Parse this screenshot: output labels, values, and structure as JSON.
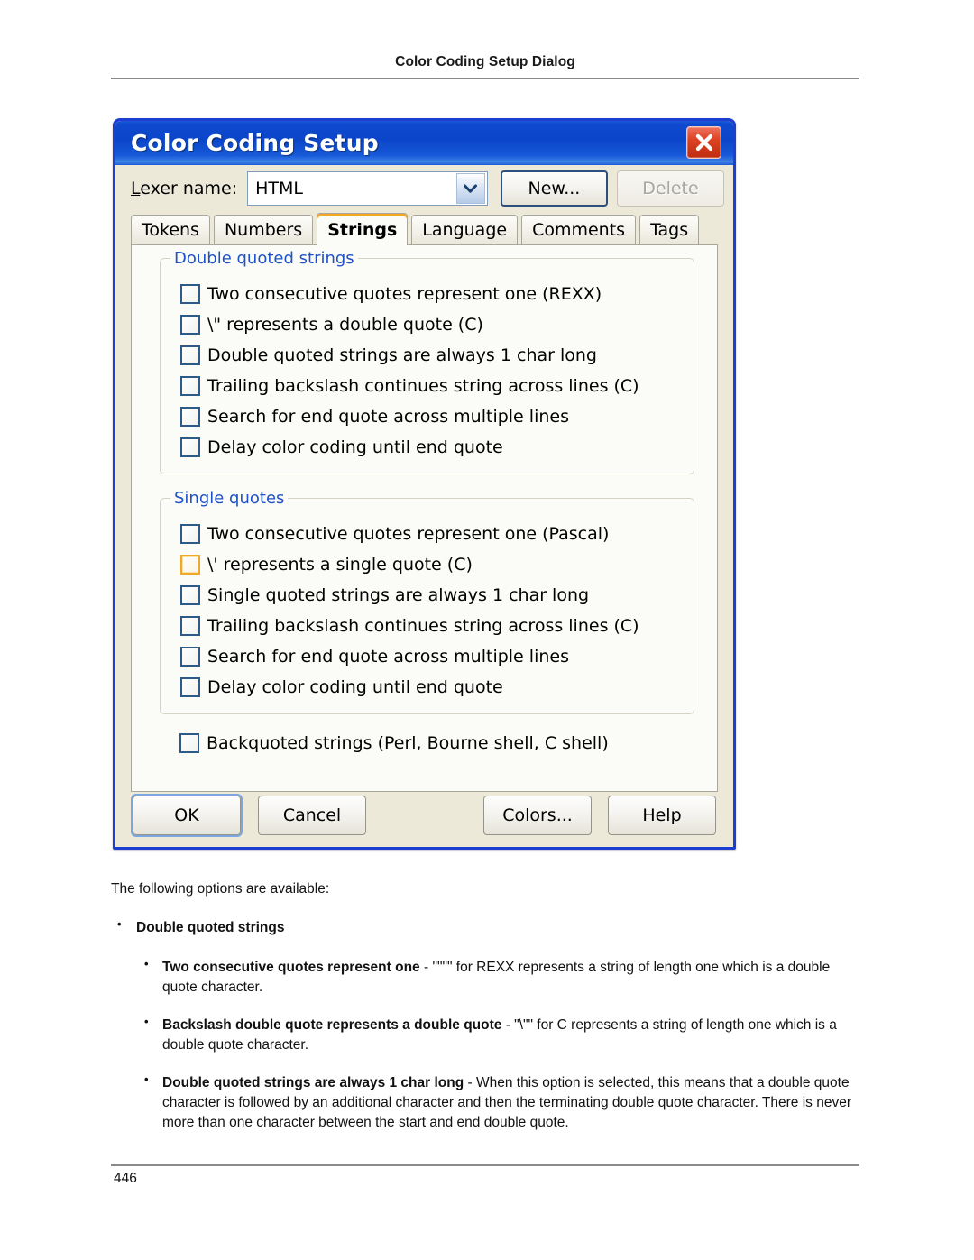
{
  "page": {
    "header_title": "Color Coding Setup Dialog",
    "page_number": "446"
  },
  "dialog": {
    "title": "Color Coding Setup",
    "close_icon": "close-x-icon",
    "lexer": {
      "label_prefix": "L",
      "label_rest": "exer name:",
      "value": "HTML",
      "dropdown_icon": "chevron-down-icon"
    },
    "buttons": {
      "new": "New...",
      "delete": "Delete",
      "ok": "OK",
      "cancel": "Cancel",
      "colors": "Colors...",
      "help": "Help"
    },
    "tabs": [
      {
        "label": "Tokens",
        "active": false
      },
      {
        "label": "Numbers",
        "active": false
      },
      {
        "label": "Strings",
        "active": true
      },
      {
        "label": "Language",
        "active": false
      },
      {
        "label": "Comments",
        "active": false
      },
      {
        "label": "Tags",
        "active": false
      }
    ],
    "groups": [
      {
        "title": "Double quoted strings",
        "items": [
          {
            "label": "Two consecutive quotes represent one (REXX)",
            "checked": false,
            "hover": false
          },
          {
            "label": "\\\" represents a double quote (C)",
            "checked": false,
            "hover": false
          },
          {
            "label": "Double quoted strings are always 1 char long",
            "checked": false,
            "hover": false
          },
          {
            "label": "Trailing backslash continues string across lines (C)",
            "checked": false,
            "hover": false
          },
          {
            "label": "Search for end quote across multiple lines",
            "checked": false,
            "hover": false
          },
          {
            "label": "Delay color coding until end quote",
            "checked": false,
            "hover": false
          }
        ]
      },
      {
        "title": "Single quotes",
        "items": [
          {
            "label": "Two consecutive quotes represent one (Pascal)",
            "checked": false,
            "hover": false
          },
          {
            "label": "\\' represents a single quote (C)",
            "checked": false,
            "hover": true
          },
          {
            "label": "Single quoted strings are always 1 char long",
            "checked": false,
            "hover": false
          },
          {
            "label": "Trailing backslash continues string across lines (C)",
            "checked": false,
            "hover": false
          },
          {
            "label": "Search for end quote across multiple lines",
            "checked": false,
            "hover": false
          },
          {
            "label": "Delay color coding until end quote",
            "checked": false,
            "hover": false
          }
        ]
      }
    ],
    "backquoted": {
      "label": "Backquoted strings (Perl, Bourne shell, C shell)",
      "checked": false
    },
    "colors": {
      "titlebar_blue": "#0b45c9",
      "frame_blue": "#1c3fd1",
      "body_beige": "#ece9d8",
      "panel_white": "#fbfbf7",
      "group_title_blue": "#1f52c8",
      "active_tab_accent": "#f5a623",
      "close_red": "#dc4323",
      "hover_checkbox": "#f0a828"
    }
  },
  "body_copy": {
    "intro": "The following options are available:",
    "bullet_l1": "Double quoted strings",
    "items": [
      {
        "term": "Two consecutive quotes represent one",
        "rest": " - \"\"\"\" for REXX represents a string of length one which is a double quote character."
      },
      {
        "term": "Backslash double quote represents a double quote",
        "rest": " - \"\\\"\" for C represents a string of length one which is a double quote character."
      },
      {
        "term": "Double quoted strings are always 1 char long",
        "rest": " - When this option is selected, this means that a double quote character is followed by an additional character and then the terminating double quote character. There is never more than one character between the start and end double quote."
      }
    ]
  }
}
